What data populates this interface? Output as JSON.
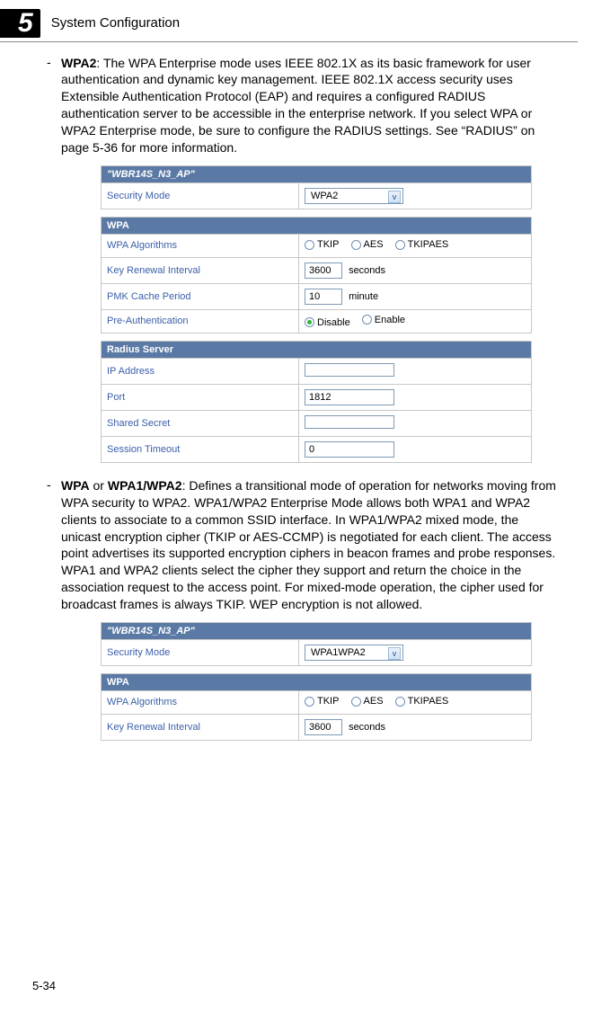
{
  "chapter": {
    "number": "5",
    "title": "System Configuration"
  },
  "page_number": "5-34",
  "bullets": {
    "wpa2": {
      "lead": "WPA2",
      "text": ": The WPA Enterprise mode uses IEEE 802.1X as its basic framework for user authentication and dynamic key management. IEEE 802.1X access security uses Extensible Authentication Protocol (EAP) and requires a configured RADIUS authentication server to be accessible in the enterprise network. If you select WPA or WPA2 Enterprise mode, be sure to configure the RADIUS settings. See “RADIUS” on page 5-36 for more information."
    },
    "wpa1wpa2": {
      "lead1": "WPA",
      "mid": " or ",
      "lead2": "WPA1/WPA2",
      "text": ": Defines a transitional mode of operation for networks moving from WPA security to WPA2. WPA1/WPA2 Enterprise Mode allows both WPA1 and WPA2 clients to associate to a common SSID interface. In WPA1/WPA2 mixed mode, the unicast encryption cipher (TKIP or AES-CCMP) is negotiated for each client. The access point advertises its supported encryption ciphers in beacon frames and probe responses. WPA1 and WPA2 clients select the cipher they support and return the choice in the association request to the access point. For mixed-mode operation, the cipher used for broadcast frames is always TKIP. WEP encryption is not allowed."
    }
  },
  "panel1": {
    "ssid_header": "\"WBR14S_N3_AP\"",
    "security_mode_label": "Security Mode",
    "security_mode_value": "WPA2",
    "wpa_header": "WPA",
    "algo_label": "WPA Algorithms",
    "algo_options": {
      "tkip": "TKIP",
      "aes": "AES",
      "tkipaes": "TKIPAES"
    },
    "key_renew_label": "Key Renewal Interval",
    "key_renew_value": "3600",
    "key_renew_unit": "seconds",
    "pmk_label": "PMK Cache Period",
    "pmk_value": "10",
    "pmk_unit": "minute",
    "preauth_label": "Pre-Authentication",
    "preauth_options": {
      "disable": "Disable",
      "enable": "Enable"
    },
    "radius_header": "Radius Server",
    "ip_label": "IP Address",
    "ip_value": "",
    "port_label": "Port",
    "port_value": "1812",
    "secret_label": "Shared Secret",
    "secret_value": "",
    "timeout_label": "Session Timeout",
    "timeout_value": "0"
  },
  "panel2": {
    "ssid_header": "\"WBR14S_N3_AP\"",
    "security_mode_label": "Security Mode",
    "security_mode_value": "WPA1WPA2",
    "wpa_header": "WPA",
    "algo_label": "WPA Algorithms",
    "algo_options": {
      "tkip": "TKIP",
      "aes": "AES",
      "tkipaes": "TKIPAES"
    },
    "key_renew_label": "Key Renewal Interval",
    "key_renew_value": "3600",
    "key_renew_unit": "seconds"
  }
}
